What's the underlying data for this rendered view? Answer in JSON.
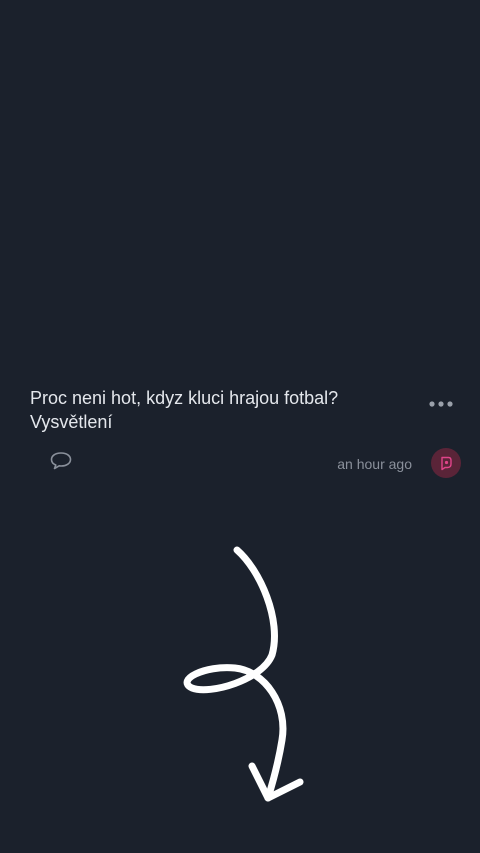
{
  "post": {
    "title_line1": "Proc neni hot, kdyz kluci hrajou fotbal?",
    "title_line2": "Vysvětlení",
    "timestamp": "an hour ago"
  },
  "icons": {
    "more": "more-dots-icon",
    "comment": "comment-bubble-icon",
    "avatar": "user-avatar-icon",
    "doodle": "hand-drawn-arrow"
  },
  "colors": {
    "background": "#1b212c",
    "title_text": "#e4e7ec",
    "meta_text": "#8a909b",
    "avatar_bg": "#5a2438",
    "avatar_accent": "#e0448a"
  }
}
